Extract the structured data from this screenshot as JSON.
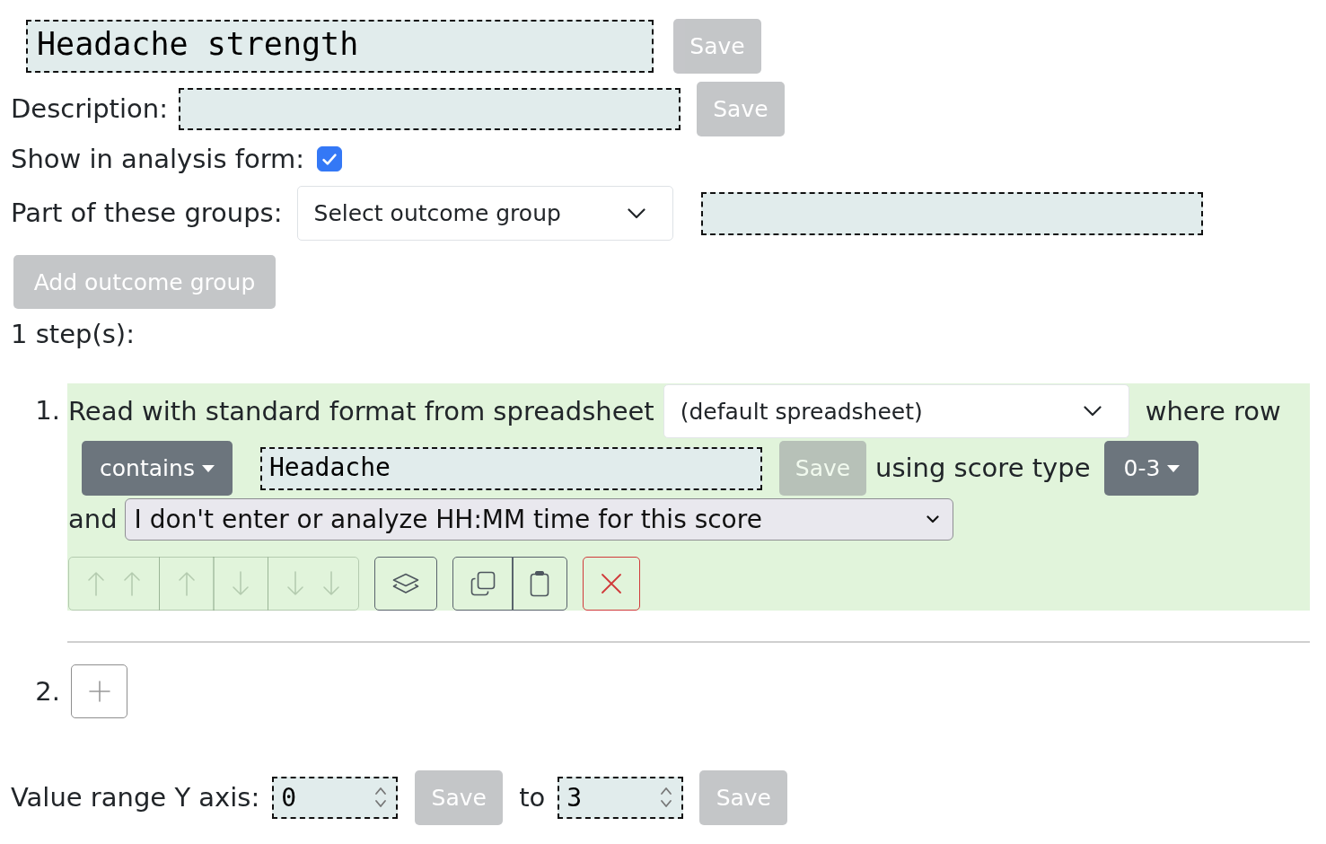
{
  "name_field": {
    "value": "Headache strength",
    "save_button": {
      "label": "Save",
      "disabled": true
    }
  },
  "description": {
    "label": "Description:",
    "save_button": {
      "label": "Save",
      "disabled": true
    }
  },
  "show_in_analysis_form": {
    "label": "Show in analysis form:",
    "checked": true
  },
  "groups": {
    "label": "Part of these groups:",
    "select": "Select outcome group",
    "add_button": {
      "label": "Add outcome group",
      "disabled": true
    }
  },
  "steps_heading": "1 step(s):",
  "steps": [
    {
      "number": "1.",
      "source_text": "Read with standard format from spreadsheet",
      "spreadsheet_select": "(default spreadsheet)",
      "row_text": "where row",
      "match_dropdown": "contains",
      "match_value": "Headache",
      "save_button": {
        "label": "Save",
        "disabled": true
      },
      "score_type_text": "using score type",
      "score_type_dropdown": "0-3",
      "time_text": "and",
      "time_select": "I don't enter or analyze HH:MM time for this score",
      "toolbar": [
        {
          "buttons": [
            {
              "kind": "move_top",
              "disabled": true
            },
            {
              "kind": "move_up",
              "disabled": true
            },
            {
              "kind": "move_down",
              "disabled": true
            },
            {
              "kind": "move_bottom",
              "disabled": true
            }
          ]
        },
        {
          "buttons": [
            {
              "kind": "layers",
              "disabled": false
            }
          ]
        },
        {
          "buttons": [
            {
              "kind": "copy",
              "disabled": false
            },
            {
              "kind": "paste",
              "disabled": false
            }
          ]
        },
        {
          "buttons": [
            {
              "kind": "delete",
              "disabled": false
            }
          ]
        }
      ]
    }
  ],
  "new_step": {
    "number": "2."
  },
  "y_axis_range": {
    "label": "Value range Y axis:",
    "min": "0",
    "min_save_button": {
      "label": "Save",
      "disabled": true
    },
    "separator": "to",
    "max": "3",
    "max_save_button": {
      "label": "Save",
      "disabled": true
    }
  }
}
